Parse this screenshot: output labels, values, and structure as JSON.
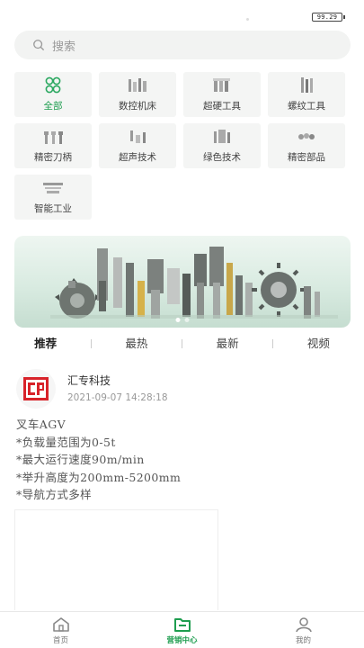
{
  "status": {
    "battery": "99.29"
  },
  "search": {
    "placeholder": "搜索"
  },
  "categories": [
    {
      "label": "全部",
      "icon": "grid-circles-icon",
      "active": true
    },
    {
      "label": "数控机床",
      "icon": "cnc-tools-icon",
      "active": false
    },
    {
      "label": "超硬工具",
      "icon": "hard-tools-icon",
      "active": false
    },
    {
      "label": "螺纹工具",
      "icon": "thread-tools-icon",
      "active": false
    },
    {
      "label": "精密刀柄",
      "icon": "tool-holder-icon",
      "active": false
    },
    {
      "label": "超声技术",
      "icon": "ultrasonic-icon",
      "active": false
    },
    {
      "label": "绿色技术",
      "icon": "green-tech-icon",
      "active": false
    },
    {
      "label": "精密部品",
      "icon": "precision-parts-icon",
      "active": false
    },
    {
      "label": "智能工业",
      "icon": "smart-industry-icon",
      "active": false
    }
  ],
  "banner": {
    "slides": 2,
    "active_slide": 0
  },
  "tabs": [
    {
      "label": "推荐",
      "active": true
    },
    {
      "label": "最热",
      "active": false
    },
    {
      "label": "最新",
      "active": false
    },
    {
      "label": "视频",
      "active": false
    }
  ],
  "post": {
    "author": "汇专科技",
    "time": "2021-09-07 14:28:18",
    "lines": [
      "叉车AGV",
      "*负载量范围为0-5t",
      "*最大运行速度90m/min",
      "*举升高度为200mm-5200mm",
      "*导航方式多样"
    ]
  },
  "nav": {
    "items": [
      {
        "label": "首页",
        "icon": "home-icon",
        "active": false
      },
      {
        "label": "营销中心",
        "icon": "folder-icon",
        "active": true
      },
      {
        "label": "我的",
        "icon": "user-icon",
        "active": false
      }
    ]
  },
  "colors": {
    "accent": "#1e9d4f",
    "logo_red": "#d8232a"
  }
}
